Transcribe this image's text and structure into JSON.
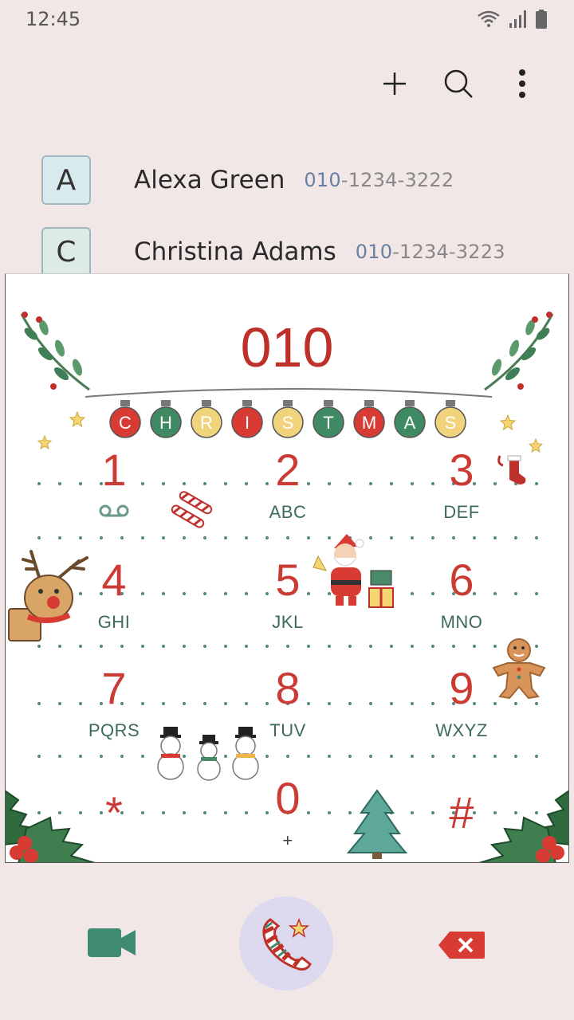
{
  "status": {
    "time": "12:45"
  },
  "toolbar": {
    "add_icon": "plus-icon",
    "search_icon": "search-icon",
    "more_icon": "more-vert-icon"
  },
  "contacts": [
    {
      "initial": "A",
      "name": "Alexa Green",
      "number_match": "010",
      "number_rest": "-1234-3222",
      "avatar_color": "#d9eaef"
    },
    {
      "initial": "C",
      "name": "Christina Adams",
      "number_match": "010",
      "number_rest": "-1234-3223",
      "avatar_color": "#dcebe3"
    }
  ],
  "dialpad": {
    "dialed_number": "010",
    "banner_letters": [
      "C",
      "H",
      "R",
      "I",
      "S",
      "T",
      "M",
      "A",
      "S"
    ],
    "keys": [
      {
        "digit": "1",
        "letters": ""
      },
      {
        "digit": "2",
        "letters": "ABC"
      },
      {
        "digit": "3",
        "letters": "DEF"
      },
      {
        "digit": "4",
        "letters": "GHI"
      },
      {
        "digit": "5",
        "letters": "JKL"
      },
      {
        "digit": "6",
        "letters": "MNO"
      },
      {
        "digit": "7",
        "letters": "PQRS"
      },
      {
        "digit": "8",
        "letters": "TUV"
      },
      {
        "digit": "9",
        "letters": "WXYZ"
      },
      {
        "digit": "*",
        "letters": ""
      },
      {
        "digit": "0",
        "letters": "+"
      },
      {
        "digit": "#",
        "letters": ""
      }
    ]
  },
  "colors": {
    "accent_red": "#cc3b33",
    "accent_green": "#3c6b5d",
    "call_bg": "#dcd8ee"
  }
}
